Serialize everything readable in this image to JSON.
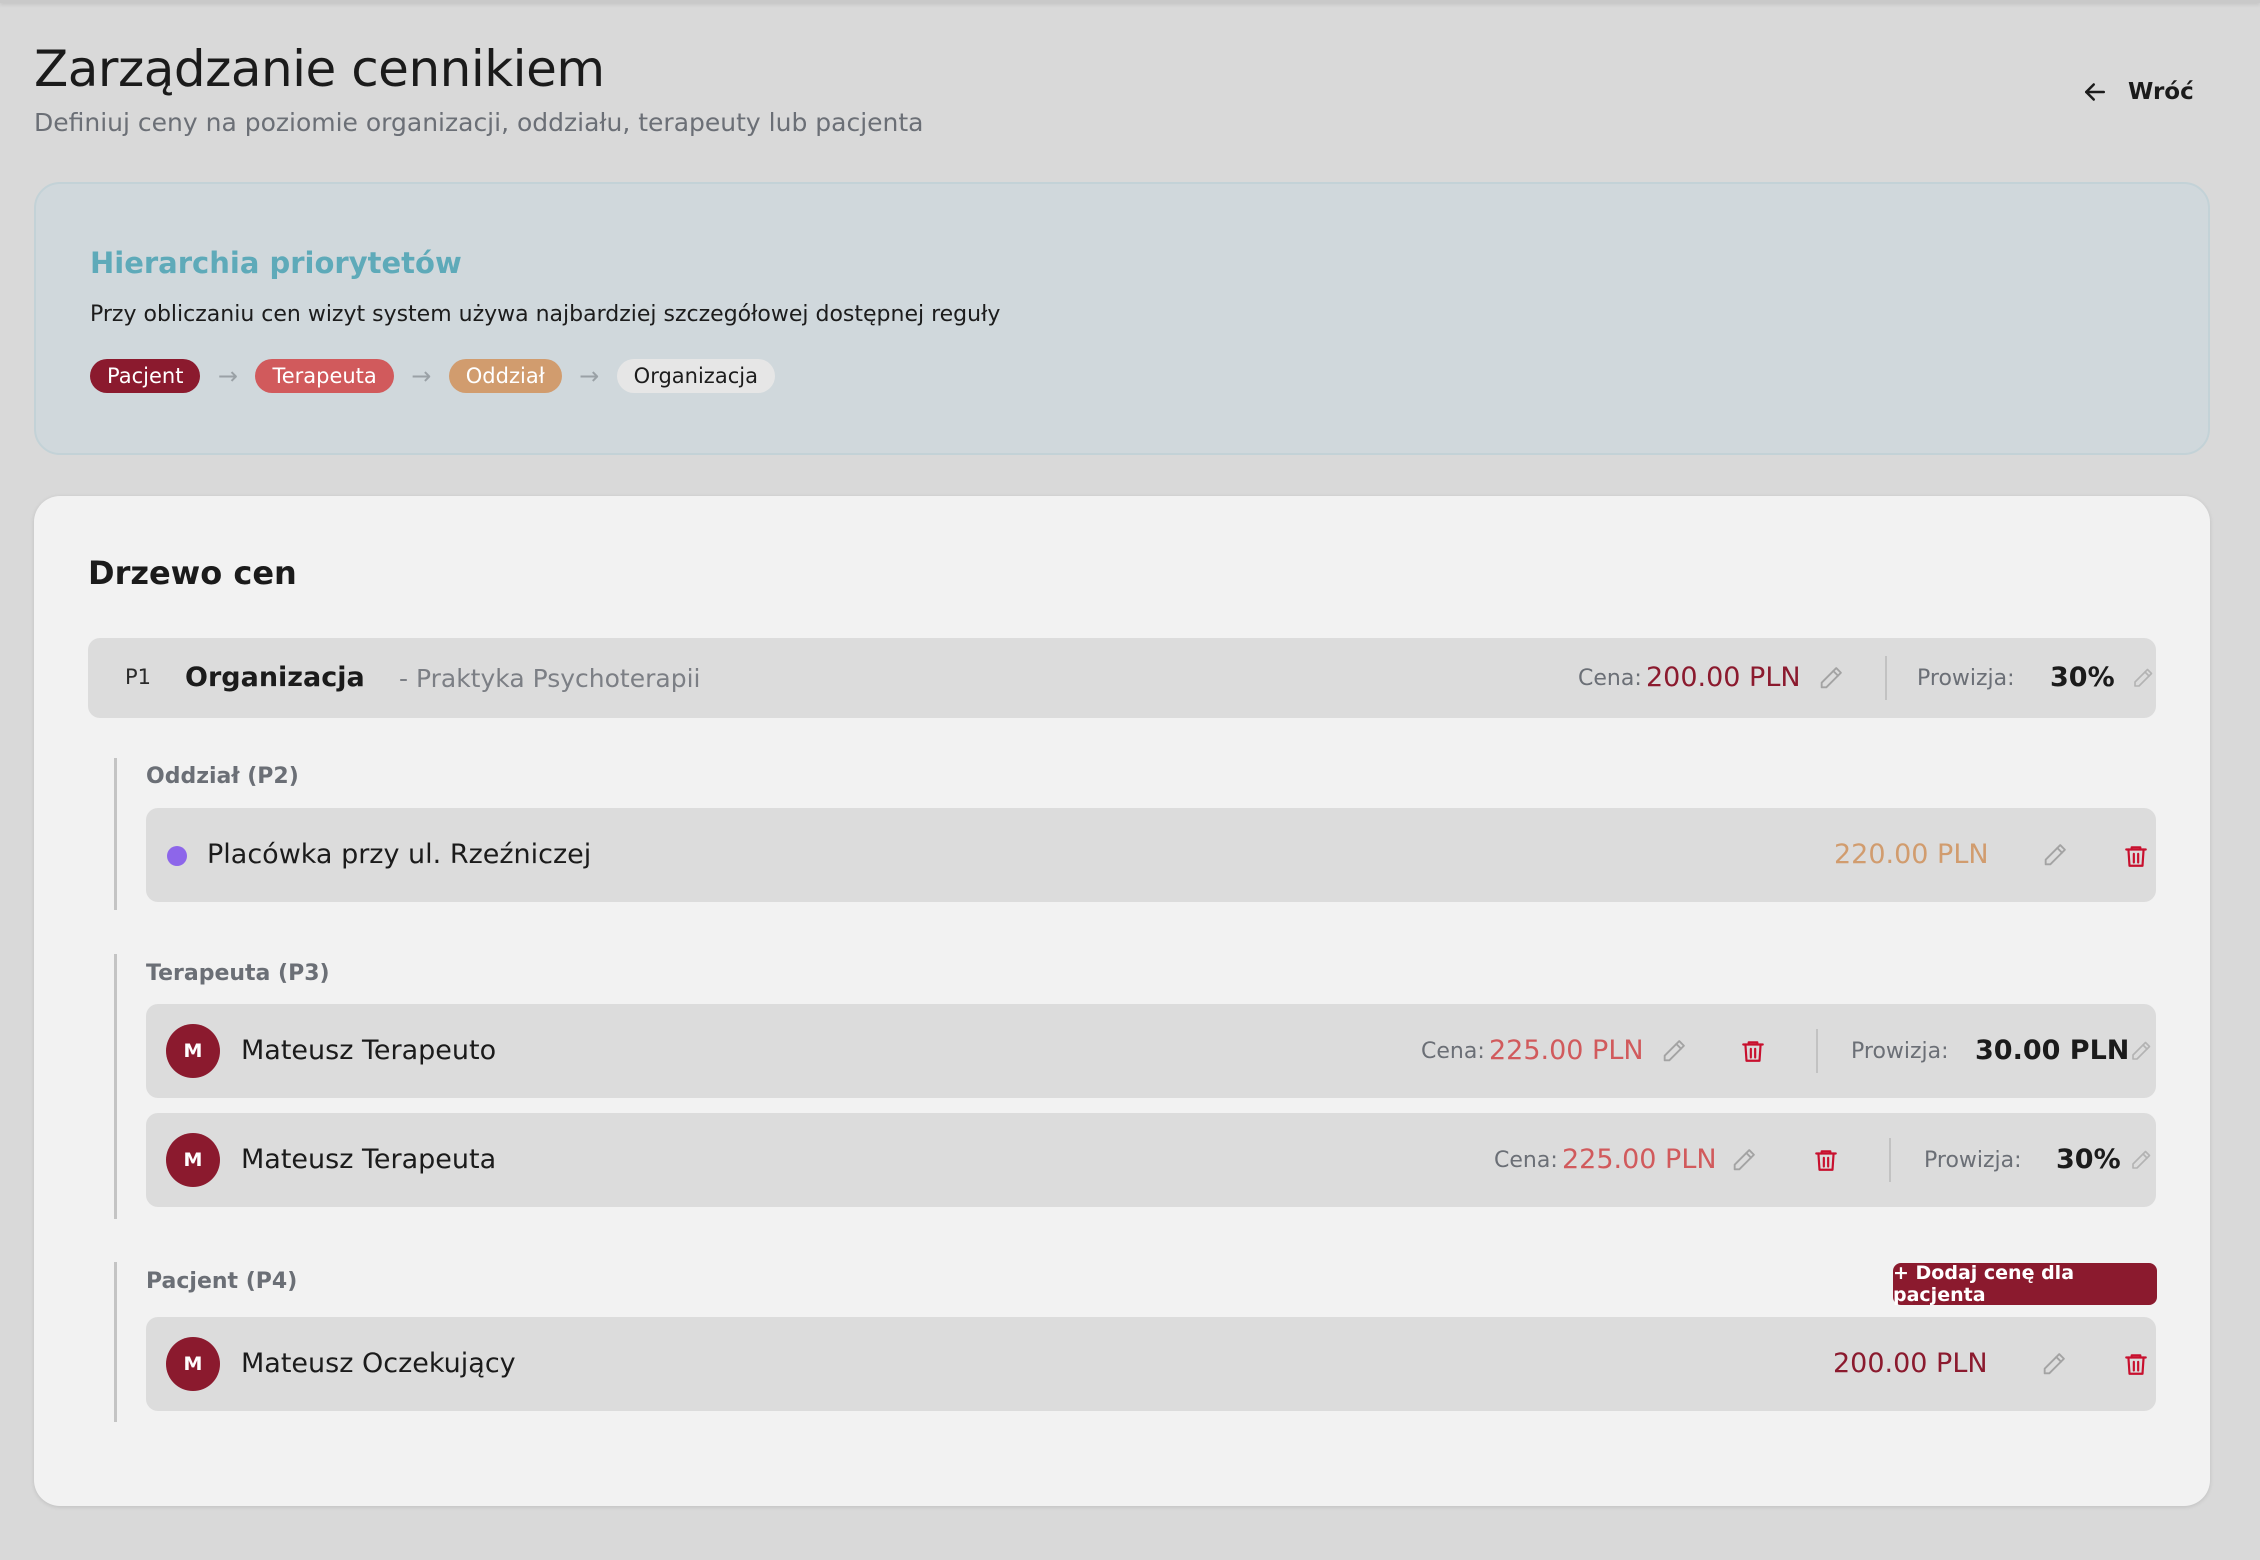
{
  "header": {
    "title": "Zarządzanie cennikiem",
    "subtitle": "Definiuj ceny na poziomie organizacji, oddziału, terapeuty lub pacjenta",
    "back_label": "Wróć"
  },
  "hierarchy": {
    "title": "Hierarchia priorytetów",
    "description": "Przy obliczaniu cen wizyt system używa najbardziej szczegółowej dostępnej reguły",
    "chips": [
      "Pacjent",
      "Terapeuta",
      "Oddział",
      "Organizacja"
    ],
    "arrow": "→"
  },
  "tree": {
    "title": "Drzewo cen",
    "organization": {
      "badge": "P1",
      "name": "Organizacja",
      "subtitle": "- Praktyka Psychoterapii",
      "price_label": "Cena:",
      "price": "200.00 PLN",
      "commission_label": "Prowizja:",
      "commission": "30%"
    },
    "branch": {
      "group_label": "Oddział (P2)",
      "items": [
        {
          "name": "Placówka przy ul. Rzeźniczej",
          "price": "220.00 PLN"
        }
      ]
    },
    "therapist": {
      "group_label": "Terapeuta (P3)",
      "items": [
        {
          "initial": "M",
          "name": "Mateusz Terapeuto",
          "price_label": "Cena:",
          "price": "225.00 PLN",
          "commission_label": "Prowizja:",
          "commission": "30.00 PLN"
        },
        {
          "initial": "M",
          "name": "Mateusz Terapeuta",
          "price_label": "Cena:",
          "price": "225.00 PLN",
          "commission_label": "Prowizja:",
          "commission": "30%"
        }
      ]
    },
    "patient": {
      "group_label": "Pacjent (P4)",
      "add_button": "+ Dodaj cenę dla pacjenta",
      "items": [
        {
          "initial": "M",
          "name": "Mateusz Oczekujący",
          "price": "200.00 PLN"
        }
      ]
    }
  },
  "colors": {
    "accent": "#8b1a2e",
    "therapist": "#d15a5c",
    "branch": "#d19c6e",
    "hierarchy_title": "#5eaab9",
    "branch_dot": "#8d66ea"
  },
  "icons": [
    "arrow-left-icon",
    "pencil-icon",
    "trash-icon"
  ]
}
